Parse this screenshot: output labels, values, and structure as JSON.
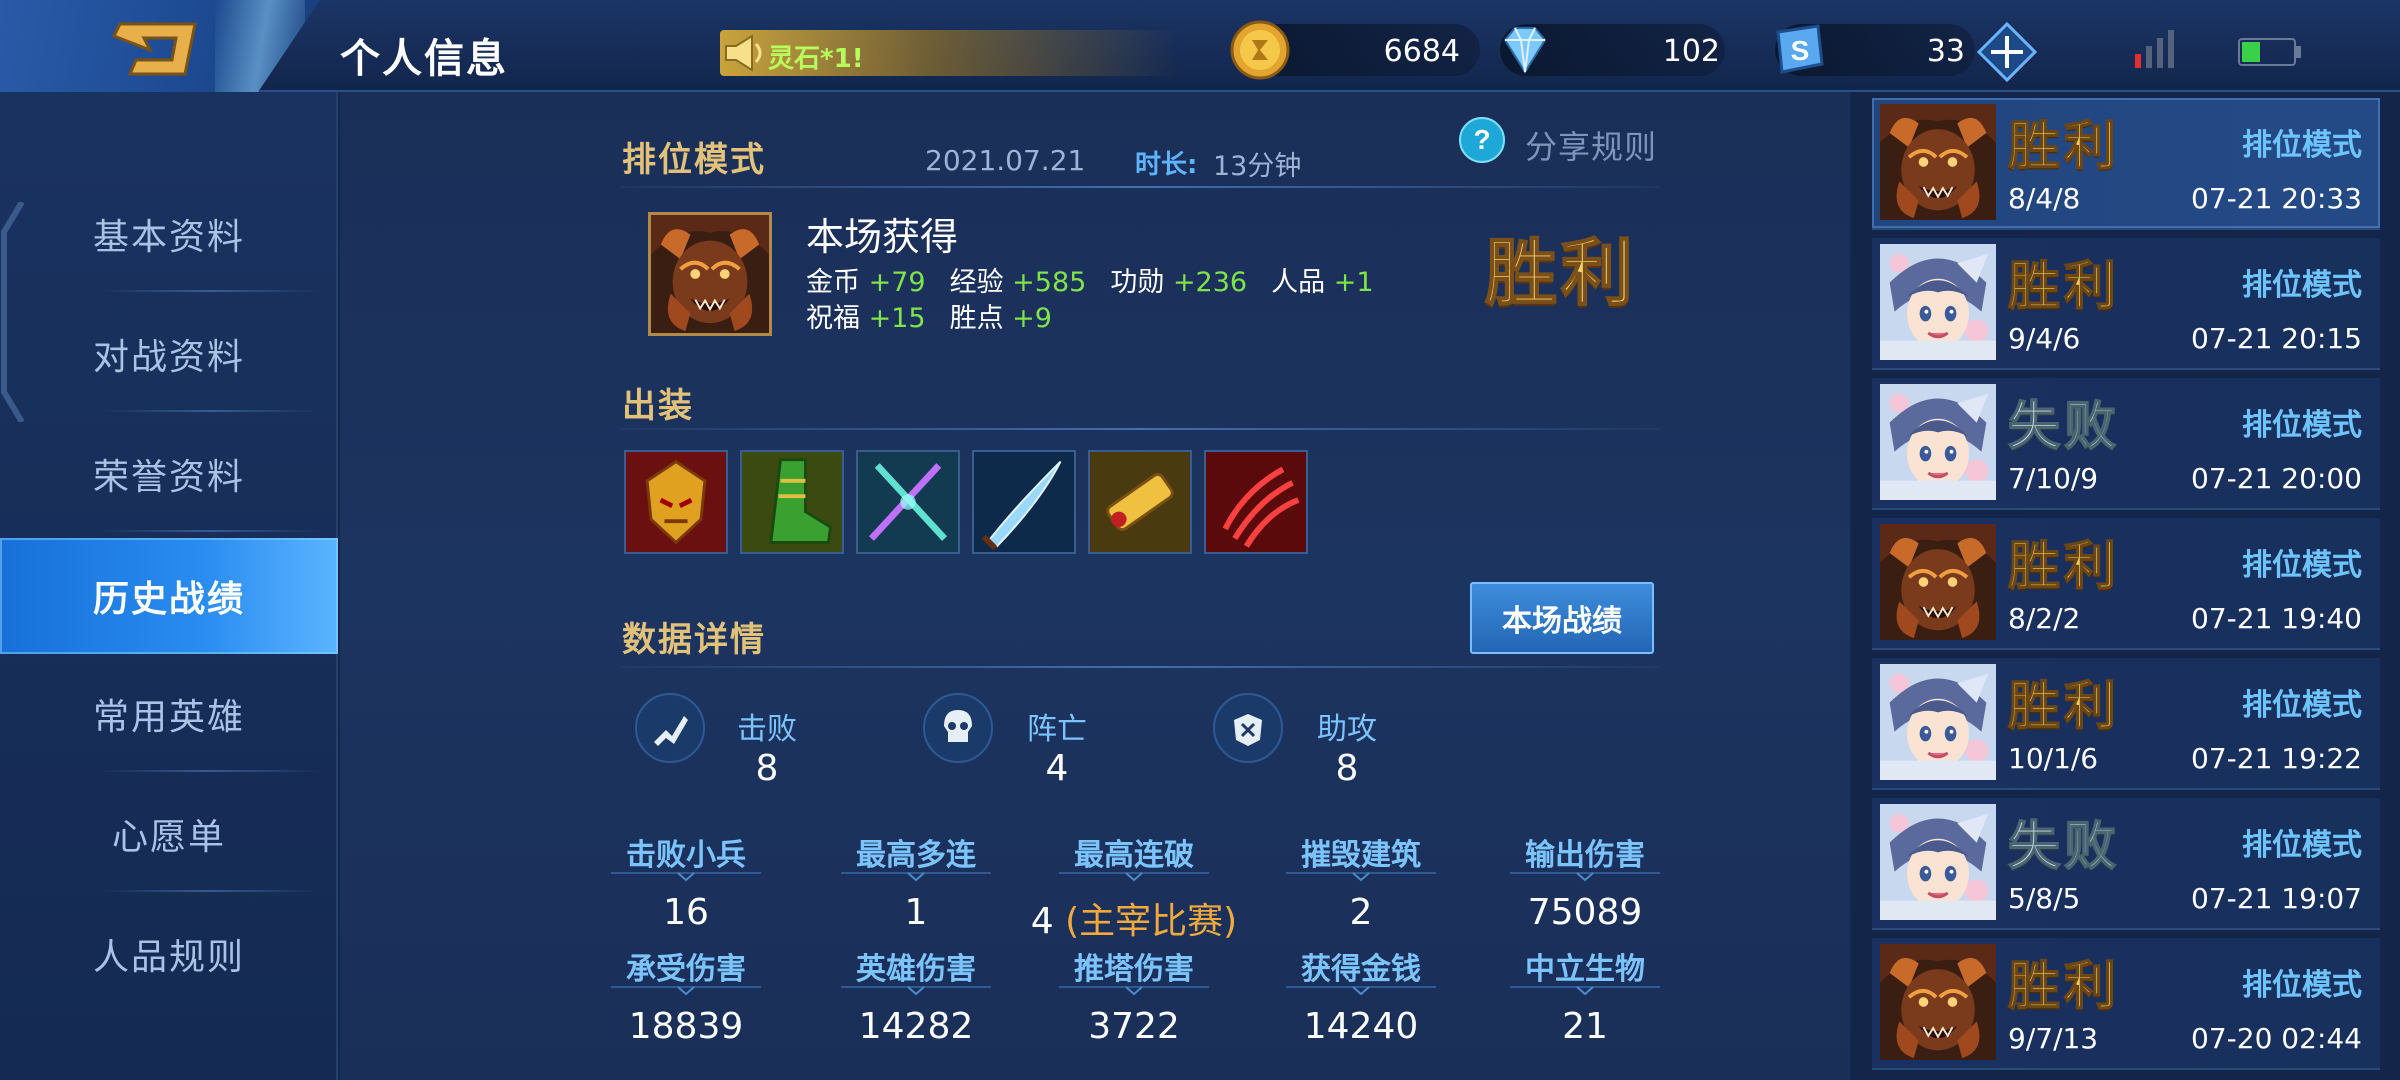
{
  "header": {
    "title": "个人信息",
    "notice_text": "灵石*1!",
    "gold": "6684",
    "diamond": "102",
    "vouchers": "33",
    "icons": [
      "back-icon",
      "speaker-icon",
      "gold-coin-icon",
      "diamond-icon",
      "voucher-icon",
      "plus-icon",
      "signal-icon",
      "battery-icon"
    ]
  },
  "nav": {
    "items": [
      {
        "label": "基本资料",
        "active": false
      },
      {
        "label": "对战资料",
        "active": false
      },
      {
        "label": "荣誉资料",
        "active": false
      },
      {
        "label": "历史战绩",
        "active": true
      },
      {
        "label": "常用英雄",
        "active": false
      },
      {
        "label": "心愿单",
        "active": false
      },
      {
        "label": "人品规则",
        "active": false
      }
    ]
  },
  "match": {
    "mode": "排位模式",
    "date": "2021.07.21",
    "duration_label": "时长:",
    "duration": "13分钟",
    "share": "分享规则",
    "earn_title": "本场获得",
    "rewards_row1": [
      {
        "k": "金币",
        "v": "+79"
      },
      {
        "k": "经验",
        "v": "+585"
      },
      {
        "k": "功勋",
        "v": "+236"
      },
      {
        "k": "人品",
        "v": "+1"
      }
    ],
    "rewards_row2": [
      {
        "k": "祝福",
        "v": "+15"
      },
      {
        "k": "胜点",
        "v": "+9"
      }
    ],
    "result": "胜利",
    "equip_label": "出装",
    "items": [
      "helmet-item-icon",
      "boots-item-icon",
      "swords-item-icon",
      "blade-item-icon",
      "scroll-item-icon",
      "claw-item-icon"
    ],
    "detail_label": "数据详情",
    "stats_button": "本场战绩",
    "kda": [
      {
        "label": "击败",
        "value": "8",
        "icon": "kill-icon"
      },
      {
        "label": "阵亡",
        "value": "4",
        "icon": "skull-icon"
      },
      {
        "label": "助攻",
        "value": "8",
        "icon": "assist-icon"
      }
    ],
    "stats_row1": [
      {
        "label": "击败小兵",
        "value": "16",
        "note": ""
      },
      {
        "label": "最高多连",
        "value": "1",
        "note": ""
      },
      {
        "label": "最高连破",
        "value": "4",
        "note": "(主宰比赛)"
      },
      {
        "label": "摧毁建筑",
        "value": "2",
        "note": ""
      },
      {
        "label": "输出伤害",
        "value": "75089",
        "note": ""
      }
    ],
    "stats_row2": [
      {
        "label": "承受伤害",
        "value": "18839"
      },
      {
        "label": "英雄伤害",
        "value": "14282"
      },
      {
        "label": "推塔伤害",
        "value": "3722"
      },
      {
        "label": "获得金钱",
        "value": "14240"
      },
      {
        "label": "中立生物",
        "value": "21"
      }
    ]
  },
  "history": [
    {
      "result": "胜利",
      "win": true,
      "mode": "排位模式",
      "kda": "8/4/8",
      "time": "07-21 20:33",
      "hero": "warrior",
      "selected": true
    },
    {
      "result": "胜利",
      "win": true,
      "mode": "排位模式",
      "kda": "9/4/6",
      "time": "07-21 20:15",
      "hero": "girl",
      "selected": false
    },
    {
      "result": "失败",
      "win": false,
      "mode": "排位模式",
      "kda": "7/10/9",
      "time": "07-21 20:00",
      "hero": "girl",
      "selected": false
    },
    {
      "result": "胜利",
      "win": true,
      "mode": "排位模式",
      "kda": "8/2/2",
      "time": "07-21 19:40",
      "hero": "warrior",
      "selected": false
    },
    {
      "result": "胜利",
      "win": true,
      "mode": "排位模式",
      "kda": "10/1/6",
      "time": "07-21 19:22",
      "hero": "girl",
      "selected": false
    },
    {
      "result": "失败",
      "win": false,
      "mode": "排位模式",
      "kda": "5/8/5",
      "time": "07-21 19:07",
      "hero": "girl",
      "selected": false
    },
    {
      "result": "胜利",
      "win": true,
      "mode": "排位模式",
      "kda": "9/7/13",
      "time": "07-20 02:44",
      "hero": "warrior",
      "selected": false
    }
  ],
  "colors": {
    "accent_gold": "#e2c27a",
    "win_gold": "#f2cf62",
    "reward_green": "#7fe34a",
    "label_blue": "#7cc4ff",
    "active_nav": "#2a8cf0"
  }
}
